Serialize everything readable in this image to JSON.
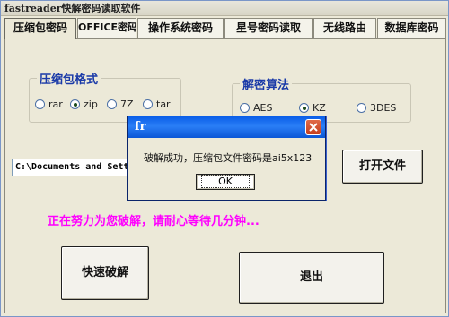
{
  "window": {
    "title": "fastreader快解密码读取软件"
  },
  "tabs": [
    {
      "label": "压缩包密码",
      "active": true
    },
    {
      "label": "OFFICE密码",
      "active": false
    },
    {
      "label": "操作系统密码",
      "active": false
    },
    {
      "label": "星号密码读取",
      "active": false
    },
    {
      "label": "无线路由",
      "active": false
    },
    {
      "label": "数据库密码",
      "active": false
    }
  ],
  "format_group": {
    "label": "压缩包格式",
    "options": [
      {
        "label": "rar",
        "selected": false
      },
      {
        "label": "zip",
        "selected": true
      },
      {
        "label": "7Z",
        "selected": false
      },
      {
        "label": "tar",
        "selected": false
      }
    ]
  },
  "algo_group": {
    "label": "解密算法",
    "options": [
      {
        "label": "AES",
        "selected": false
      },
      {
        "label": "KZ",
        "selected": true
      },
      {
        "label": "3DES",
        "selected": false
      }
    ]
  },
  "path_field": {
    "value": "C:\\Documents and Settings"
  },
  "buttons": {
    "open_file": "打开文件",
    "quick_crack": "快速破解",
    "exit": "退出"
  },
  "status": {
    "text": "正在努力为您破解，请耐心等待几分钟..."
  },
  "dialog": {
    "title": "fr",
    "message": "破解成功，压缩包文件密码是ai5x123",
    "ok_label": "OK"
  }
}
